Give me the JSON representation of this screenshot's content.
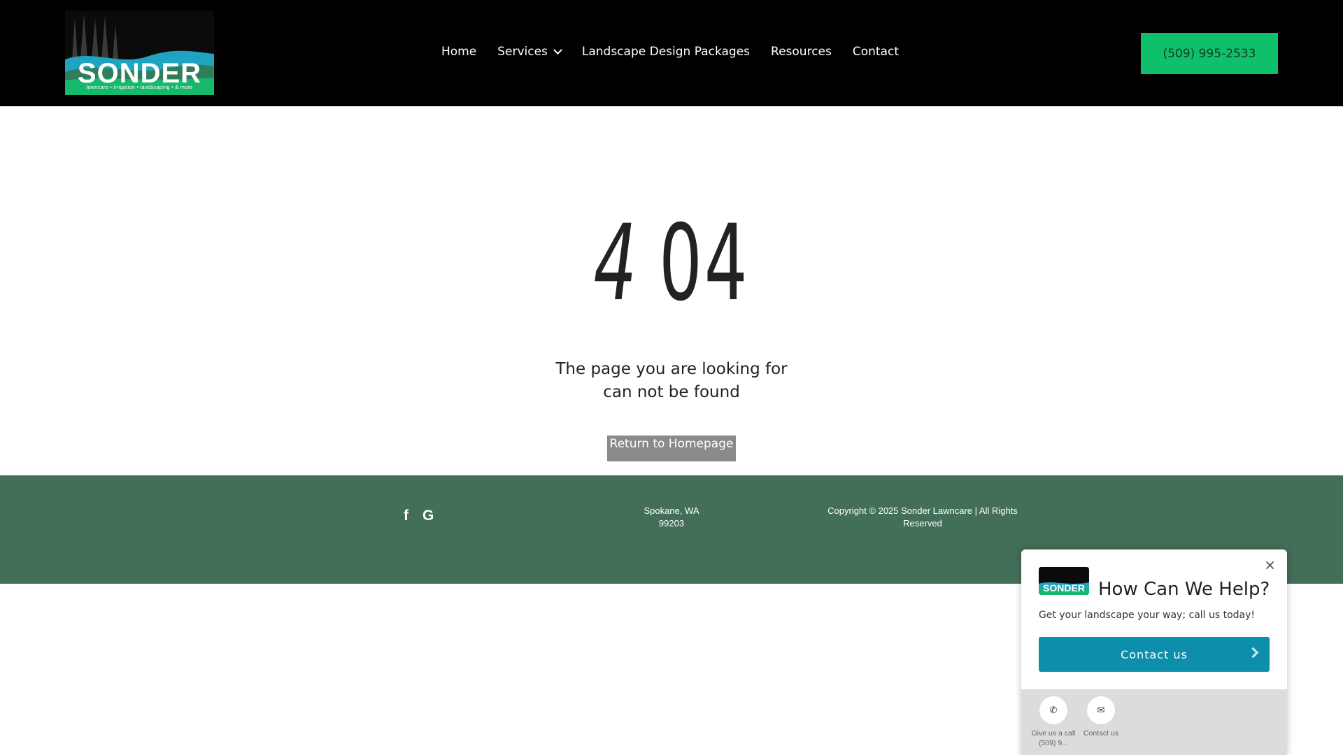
{
  "header": {
    "logo": {
      "word": "SONDER",
      "tagline": "lawncare  •  irrigation  •  landscaping  •  & more"
    },
    "nav": [
      {
        "label": "Home"
      },
      {
        "label": "Services"
      },
      {
        "label": "Landscape Design Packages"
      },
      {
        "label": "Resources"
      },
      {
        "label": "Contact"
      }
    ],
    "phone_button": "(509) 995-2533"
  },
  "main": {
    "error_code_first": "4",
    "error_code_rest": "04",
    "message_line1": "The page you are looking for",
    "message_line2": "can not be found",
    "return_button": "Return to Homepage"
  },
  "footer": {
    "social": [
      {
        "icon": "facebook-icon",
        "glyph": "f"
      },
      {
        "icon": "google-icon",
        "glyph": "G"
      }
    ],
    "address_line1": "Spokane, WA",
    "address_line2": "99203",
    "copyright_line1": "Copyright © 2025 Sonder Lawncare | All Rights",
    "copyright_line2": "Reserved"
  },
  "widget": {
    "close": "×",
    "logo_word": "SONDER",
    "title": "How Can We Help?",
    "subtitle": "Get your landscape your way; call us today!",
    "button": "Contact us",
    "actions": [
      {
        "icon": "phone-icon",
        "label_line1": "Give us a call",
        "label_line2": "(509) 9..."
      },
      {
        "icon": "mail-icon",
        "label_line1": "Contact us",
        "label_line2": ""
      }
    ]
  },
  "colors": {
    "header_bg": "#000000",
    "accent_green": "#0fbf6a",
    "footer_bg": "#436e58",
    "widget_button": "#0d8fac",
    "return_button": "#8a8a8a"
  }
}
